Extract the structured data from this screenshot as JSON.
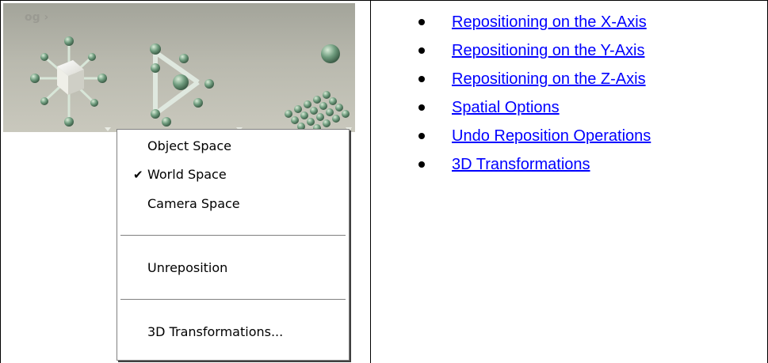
{
  "toolbar_image": {
    "faint_label": "og ›"
  },
  "context_menu": {
    "items": [
      {
        "label": "Object Space",
        "checked": false
      },
      {
        "label": "World Space",
        "checked": true
      },
      {
        "label": "Camera Space",
        "checked": false
      }
    ],
    "check_glyph": "✔",
    "unreposition_label": "Unreposition",
    "transformations_label": "3D Transformations..."
  },
  "links": [
    "Repositioning on the X-Axis",
    "Repositioning on the Y-Axis",
    "Repositioning on the Z-Axis",
    "Spatial Options",
    "Undo Reposition Operations",
    "3D Transformations"
  ],
  "colors": {
    "link": "#0000ff",
    "toolbar_bg": "#b9b9ae",
    "sphere": "#6f9c7e"
  }
}
